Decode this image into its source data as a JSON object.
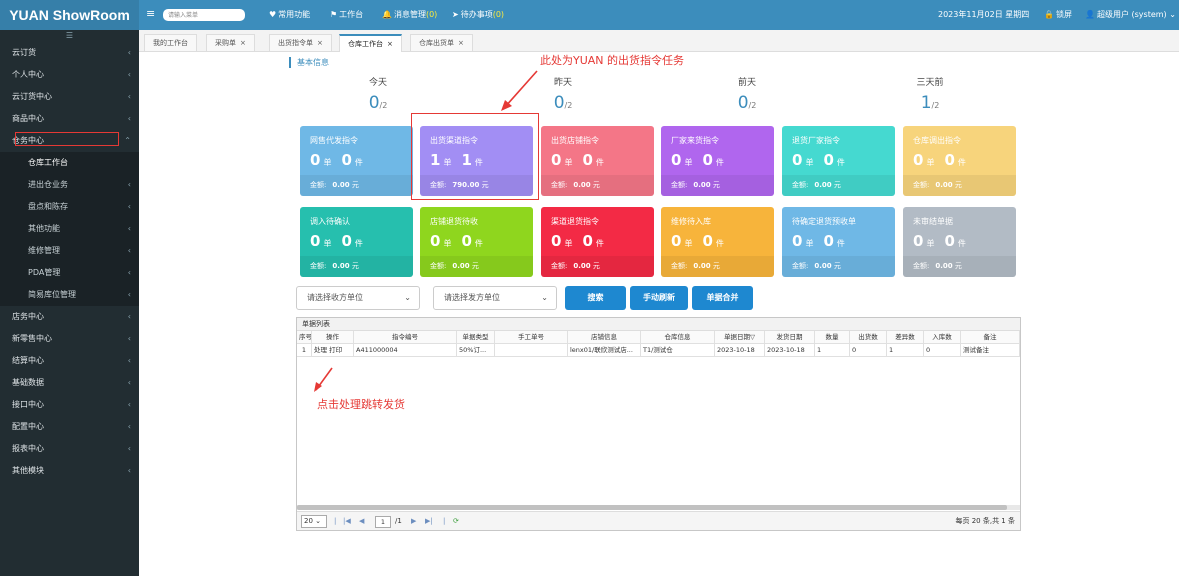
{
  "app": {
    "logo": "YUAN ShowRoom"
  },
  "topbar": {
    "search_placeholder": "请输入菜单",
    "menu_icon": "menu-icon",
    "common": "常用功能",
    "workbench": "工作台",
    "messages": "消息管理",
    "messages_count": "(0)",
    "todo": "待办事项",
    "todo_count": "(0)",
    "date": "2023年11月02日 星期四",
    "lock": "锁屏",
    "user": "超级用户 (system)"
  },
  "sidebar": {
    "toggle": "☰",
    "items": [
      {
        "label": "云订货",
        "expanded": false
      },
      {
        "label": "个人中心",
        "expanded": false
      },
      {
        "label": "云订货中心",
        "expanded": false
      },
      {
        "label": "商品中心",
        "expanded": false
      },
      {
        "label": "仓务中心",
        "expanded": true
      },
      {
        "label": "仓库工作台",
        "sub": true,
        "active": true
      },
      {
        "label": "进出仓业务",
        "sub": true
      },
      {
        "label": "盘点和陈存",
        "sub": true
      },
      {
        "label": "其他功能",
        "sub": true
      },
      {
        "label": "维修管理",
        "sub": true
      },
      {
        "label": "PDA管理",
        "sub": true
      },
      {
        "label": "简易库位管理",
        "sub": true
      },
      {
        "label": "店务中心",
        "expanded": false
      },
      {
        "label": "新零售中心",
        "expanded": false
      },
      {
        "label": "结算中心",
        "expanded": false
      },
      {
        "label": "基础数据",
        "expanded": false
      },
      {
        "label": "接口中心",
        "expanded": false
      },
      {
        "label": "配置中心",
        "expanded": false
      },
      {
        "label": "报表中心",
        "expanded": false
      },
      {
        "label": "其他模块",
        "expanded": false
      }
    ]
  },
  "tabs": [
    {
      "label": "我的工作台",
      "closable": false
    },
    {
      "label": "采购单",
      "closable": true
    },
    {
      "label": "出货指令单",
      "closable": true
    },
    {
      "label": "仓库工作台",
      "closable": true,
      "active": true
    },
    {
      "label": "仓库出货单",
      "closable": true
    }
  ],
  "basic_info": "基本信息",
  "days": [
    {
      "label": "今天",
      "value": "0",
      "total": "/2"
    },
    {
      "label": "昨天",
      "value": "0",
      "total": "/2"
    },
    {
      "label": "前天",
      "value": "0",
      "total": "/2"
    },
    {
      "label": "三天前",
      "value": "1",
      "total": "/2"
    }
  ],
  "units": {
    "dan": "单",
    "jian": "件",
    "amount": "金额:",
    "yuan": "元"
  },
  "cards": [
    {
      "title": "网售代发指令",
      "orders": "0",
      "pieces": "0",
      "amount": "0.00",
      "color": "#6fb8e6"
    },
    {
      "title": "出货渠道指令",
      "orders": "1",
      "pieces": "1",
      "amount": "790.00",
      "color": "#a28ef4"
    },
    {
      "title": "出货店铺指令",
      "orders": "0",
      "pieces": "0",
      "amount": "0.00",
      "color": "#f47687"
    },
    {
      "title": "厂家来货指令",
      "orders": "0",
      "pieces": "0",
      "amount": "0.00",
      "color": "#b066ee"
    },
    {
      "title": "退货厂家指令",
      "orders": "0",
      "pieces": "0",
      "amount": "0.00",
      "color": "#45d9d0"
    },
    {
      "title": "仓库调出指令",
      "orders": "0",
      "pieces": "0",
      "amount": "0.00",
      "color": "#f7d47c"
    },
    {
      "title": "调入待确认",
      "orders": "0",
      "pieces": "0",
      "amount": "0.00",
      "color": "#26bfae"
    },
    {
      "title": "店铺退货待收",
      "orders": "0",
      "pieces": "0",
      "amount": "0.00",
      "color": "#8fd61e"
    },
    {
      "title": "渠道退货指令",
      "orders": "0",
      "pieces": "0",
      "amount": "0.00",
      "color": "#f32a45"
    },
    {
      "title": "维修待入库",
      "orders": "0",
      "pieces": "0",
      "amount": "0.00",
      "color": "#f7b43b"
    },
    {
      "title": "待确定退货预收单",
      "orders": "0",
      "pieces": "0",
      "amount": "0.00",
      "color": "#6fb8e6"
    },
    {
      "title": "未审结单据",
      "orders": "0",
      "pieces": "0",
      "amount": "0.00",
      "color": "#b2bbc5"
    }
  ],
  "filters": {
    "receiver": "请选择收方单位",
    "sender": "请选择发方单位",
    "search_btn": "搜索",
    "refresh_btn": "手动刷新",
    "merge_btn": "单据合并"
  },
  "grid": {
    "title": "单据列表",
    "columns": [
      "序号",
      "操作",
      "指令编号",
      "单据类型",
      "手工单号",
      "店铺信息",
      "仓库信息",
      "单据日期▽",
      "发货日期",
      "数量",
      "出货数",
      "差异数",
      "入库数",
      "备注"
    ],
    "rows": [
      {
        "idx": "1",
        "op_process": "处理",
        "op_print": "打印",
        "code": "A411000004",
        "type": "50%订...",
        "manual": "",
        "shop": "lenx01/联欣测试店...",
        "warehouse": "T1/测试仓",
        "bill_date": "2023-10-18",
        "ship_date": "2023-10-18",
        "qty": "1",
        "shipped": "0",
        "diff": "1",
        "stocked": "0",
        "remark": "测试备注"
      }
    ]
  },
  "pager": {
    "page_size": "20",
    "page": "1",
    "total_pages": "/1",
    "info": "每页 20 条,共 1 条"
  },
  "annotations": {
    "top": "此处为YUAN 的出货指令任务",
    "bottom": "点击处理跳转发货",
    "color": "#e53935"
  }
}
